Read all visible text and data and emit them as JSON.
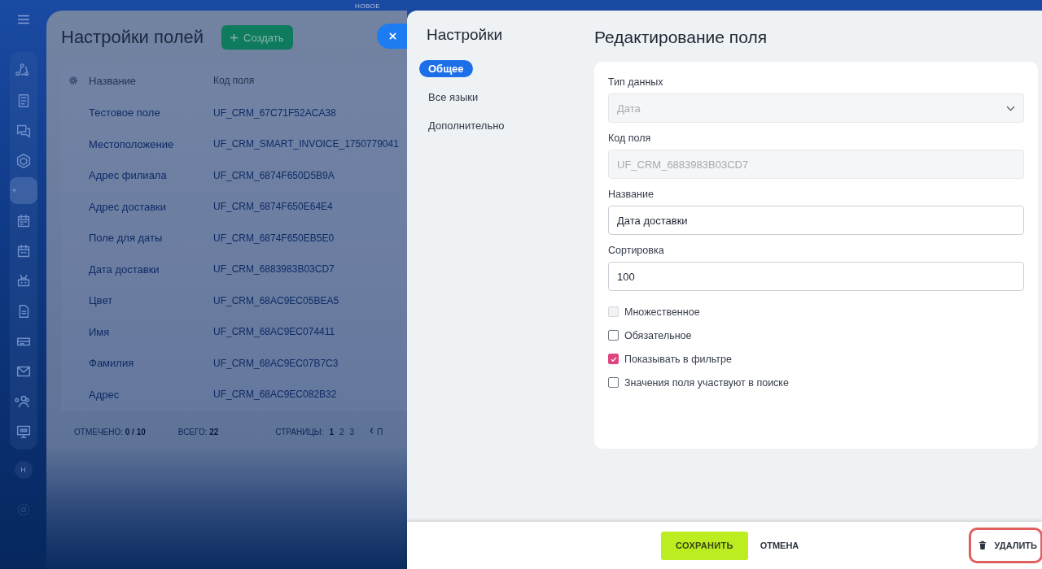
{
  "sidebar": {
    "items": [
      {
        "selected": false
      },
      {
        "selected": false
      },
      {
        "selected": false
      },
      {
        "selected": false
      },
      {
        "selected": true
      },
      {
        "selected": false
      },
      {
        "selected": false
      },
      {
        "selected": false
      },
      {
        "selected": false
      },
      {
        "selected": false
      },
      {
        "selected": false
      },
      {
        "selected": false
      },
      {
        "selected": false
      }
    ],
    "avatar": "Н"
  },
  "top_badge": "НОВОЕ",
  "fields_page": {
    "title": "Настройки полей",
    "create_button": "Создать",
    "columns": [
      "Название",
      "Код поля"
    ],
    "rows": [
      [
        "Тестовое поле",
        "UF_CRM_67C71F52ACA38"
      ],
      [
        "Местоположение",
        "UF_CRM_SMART_INVOICE_1750779041"
      ],
      [
        "Адрес филиала",
        "UF_CRM_6874F650D5B9A"
      ],
      [
        "Адрес доставки",
        "UF_CRM_6874F650E64E4"
      ],
      [
        "Поле для даты",
        "UF_CRM_6874F650EB5E0"
      ],
      [
        "Дата доставки",
        "UF_CRM_6883983B03CD7"
      ],
      [
        "Цвет",
        "UF_CRM_68AC9EC05BEA5"
      ],
      [
        "Имя",
        "UF_CRM_68AC9EC074411"
      ],
      [
        "Фамилия",
        "UF_CRM_68AC9EC07B7C3"
      ],
      [
        "Адрес",
        "UF_CRM_68AC9EC082B32"
      ]
    ],
    "footer": {
      "marked_label": "ОТМЕЧЕНО:",
      "marked_value": "0 / 10",
      "total_label": "ВСЕГО:",
      "total_value": "22",
      "pages_label": "СТРАНИЦЫ:",
      "pages": [
        "1",
        "2",
        "3"
      ],
      "next_cut": "П"
    }
  },
  "settings": {
    "title": "Настройки",
    "nav": [
      {
        "label": "Общее",
        "selected": true
      },
      {
        "label": "Все языки",
        "selected": false
      },
      {
        "label": "Дополнительно",
        "selected": false
      }
    ]
  },
  "editor": {
    "title": "Редактирование поля",
    "fields": [
      {
        "kind": "select",
        "label": "Тип данных",
        "value": "Дата",
        "disabled": true
      },
      {
        "kind": "text",
        "label": "Код поля",
        "value": "UF_CRM_6883983B03CD7",
        "disabled": true
      },
      {
        "kind": "text",
        "label": "Название",
        "value": "Дата доставки",
        "disabled": false
      },
      {
        "kind": "text",
        "label": "Сортировка",
        "value": "100",
        "disabled": false
      }
    ],
    "checkboxes": [
      {
        "label": "Множественное",
        "checked": false,
        "disabled": true
      },
      {
        "label": "Обязательное",
        "checked": false,
        "disabled": false
      },
      {
        "label": "Показывать в фильтре",
        "checked": true,
        "disabled": false
      },
      {
        "label": "Значения поля участвуют в поиске",
        "checked": false,
        "disabled": false
      }
    ]
  },
  "buttons": {
    "save": "СОХРАНИТЬ",
    "cancel": "ОТМЕНА",
    "delete": {
      "label": "УДАЛИТЬ",
      "highlighted": true
    }
  }
}
